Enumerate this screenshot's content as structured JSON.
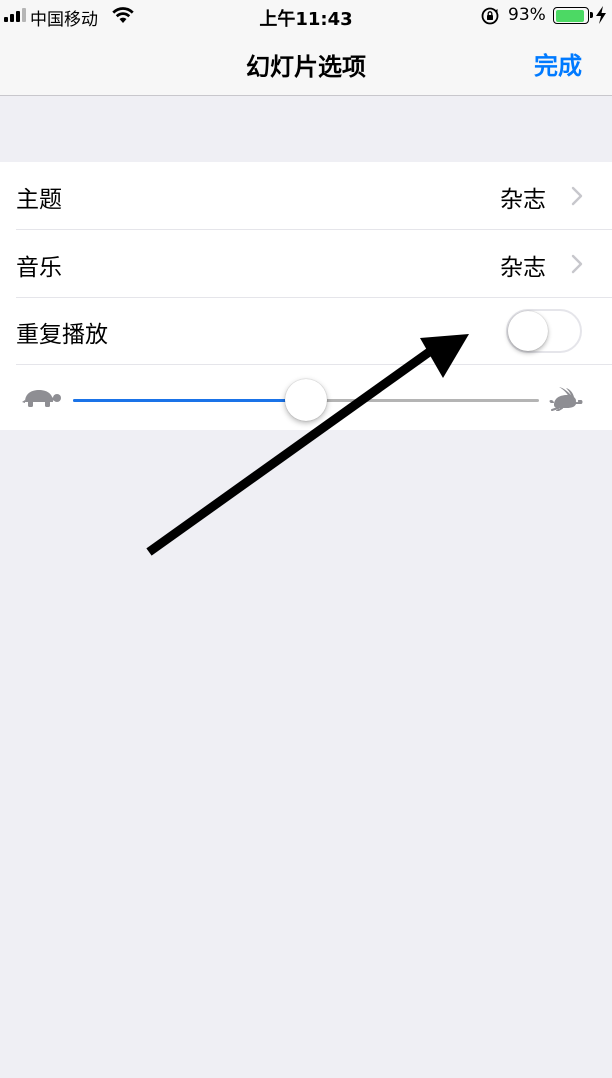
{
  "status_bar": {
    "carrier": "中国移动",
    "time": "上午11:43",
    "battery_percent": "93%",
    "battery_level": 0.93,
    "battery_color": "#4cd964",
    "icons": [
      "signal-icon",
      "wifi-icon",
      "orientation-lock-icon",
      "battery-icon",
      "charging-icon"
    ]
  },
  "nav": {
    "title": "幻灯片选项",
    "done_label": "完成",
    "accent_color": "#007aff"
  },
  "rows": [
    {
      "label": "主题",
      "value": "杂志",
      "accessory": "chevron-right-icon"
    },
    {
      "label": "音乐",
      "value": "杂志",
      "accessory": "chevron-right-icon"
    },
    {
      "label": "重复播放",
      "toggle_on": false
    }
  ],
  "speed_slider": {
    "value": 0.5,
    "min_icon": "turtle-icon",
    "max_icon": "rabbit-icon",
    "fill_color": "#1a73e8"
  }
}
